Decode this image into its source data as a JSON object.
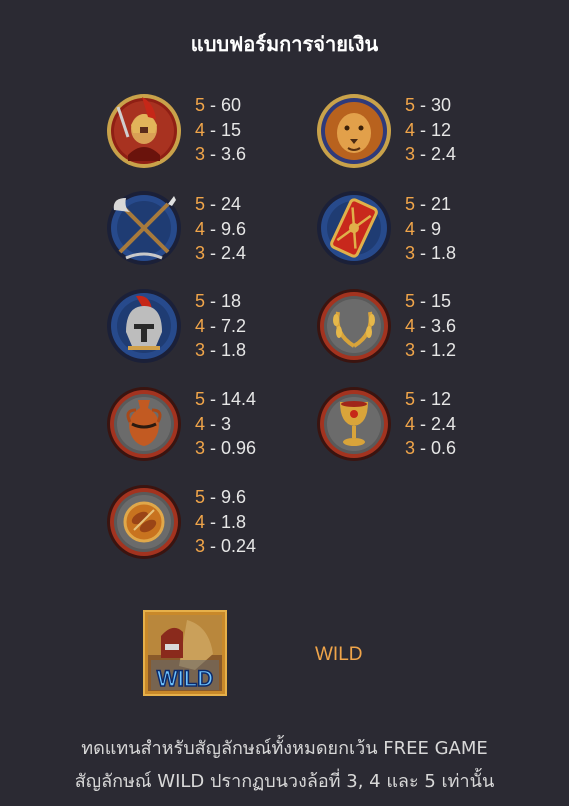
{
  "title": "แบบฟอร์มการจ่ายเงิน",
  "symbols": [
    {
      "icon": "spartan-warrior-icon",
      "pays": [
        {
          "count": "5",
          "value": "60"
        },
        {
          "count": "4",
          "value": "15"
        },
        {
          "count": "3",
          "value": "3.6"
        }
      ]
    },
    {
      "icon": "lion-icon",
      "pays": [
        {
          "count": "5",
          "value": "30"
        },
        {
          "count": "4",
          "value": "12"
        },
        {
          "count": "3",
          "value": "2.4"
        }
      ]
    },
    {
      "icon": "crossed-axe-spear-icon",
      "pays": [
        {
          "count": "5",
          "value": "24"
        },
        {
          "count": "4",
          "value": "9.6"
        },
        {
          "count": "3",
          "value": "2.4"
        }
      ]
    },
    {
      "icon": "roman-shield-icon",
      "pays": [
        {
          "count": "5",
          "value": "21"
        },
        {
          "count": "4",
          "value": "9"
        },
        {
          "count": "3",
          "value": "1.8"
        }
      ]
    },
    {
      "icon": "gladiator-helmet-icon",
      "pays": [
        {
          "count": "5",
          "value": "18"
        },
        {
          "count": "4",
          "value": "7.2"
        },
        {
          "count": "3",
          "value": "1.8"
        }
      ]
    },
    {
      "icon": "laurel-wreath-icon",
      "pays": [
        {
          "count": "5",
          "value": "15"
        },
        {
          "count": "4",
          "value": "3.6"
        },
        {
          "count": "3",
          "value": "1.2"
        }
      ]
    },
    {
      "icon": "amphora-vase-icon",
      "pays": [
        {
          "count": "5",
          "value": "14.4"
        },
        {
          "count": "4",
          "value": "3"
        },
        {
          "count": "3",
          "value": "0.96"
        }
      ]
    },
    {
      "icon": "goblet-icon",
      "pays": [
        {
          "count": "5",
          "value": "12"
        },
        {
          "count": "4",
          "value": "2.4"
        },
        {
          "count": "3",
          "value": "0.6"
        }
      ]
    },
    {
      "icon": "roasted-meat-plate-icon",
      "pays": [
        {
          "count": "5",
          "value": "9.6"
        },
        {
          "count": "4",
          "value": "1.8"
        },
        {
          "count": "3",
          "value": "0.24"
        }
      ]
    }
  ],
  "wild": {
    "icon": "wild-gladiator-icon",
    "badge_text": "WILD",
    "label": "WILD"
  },
  "description": {
    "line1": "ทดแทนสำหรับสัญลักษณ์ทั้งหมดยกเว้น FREE GAME",
    "line2": "สัญลักษณ์ WILD ปรากฏบนวงล้อที่ 3, 4 และ 5 เท่านั้น"
  },
  "colors": {
    "background": "#2b2a33",
    "count_accent": "#f0a54a",
    "text": "#e6e6e6"
  }
}
